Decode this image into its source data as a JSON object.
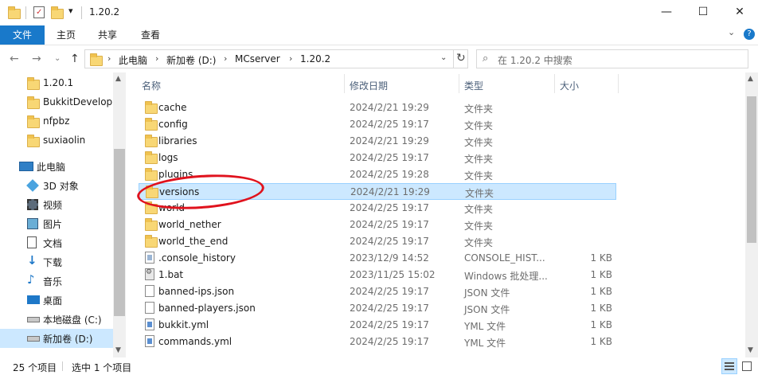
{
  "window": {
    "title": "1.20.2",
    "minimize": "—",
    "maximize": "☐",
    "close": "✕"
  },
  "ribbon": {
    "tabs": [
      {
        "label": "文件",
        "active": true
      },
      {
        "label": "主页",
        "active": false
      },
      {
        "label": "共享",
        "active": false
      },
      {
        "label": "查看",
        "active": false
      }
    ],
    "expand": "⌄",
    "help": "?"
  },
  "nav": {
    "back": "←",
    "forward": "→",
    "recent": "⌄",
    "up": "↑",
    "refresh": "↻",
    "history": "⌄"
  },
  "address": {
    "segments": [
      "此电脑",
      "新加卷 (D:)",
      "MCserver",
      "1.20.2"
    ]
  },
  "search": {
    "placeholder": "在 1.20.2 中搜索"
  },
  "navpane": {
    "folders": [
      "1.20.1",
      "BukkitDevelop",
      "nfpbz",
      "suxiaolin"
    ],
    "this_pc": "此电脑",
    "pc_items": [
      {
        "label": "3D 对象",
        "icon": "3d-objects-icon"
      },
      {
        "label": "视频",
        "icon": "video-icon"
      },
      {
        "label": "图片",
        "icon": "pictures-icon"
      },
      {
        "label": "文档",
        "icon": "documents-icon"
      },
      {
        "label": "下载",
        "icon": "downloads-icon"
      },
      {
        "label": "音乐",
        "icon": "music-icon"
      },
      {
        "label": "桌面",
        "icon": "desktop-icon"
      },
      {
        "label": "本地磁盘 (C:)",
        "icon": "drive-icon"
      },
      {
        "label": "新加卷 (D:)",
        "icon": "drive-icon"
      }
    ]
  },
  "columns": {
    "name": "名称",
    "date": "修改日期",
    "type": "类型",
    "size": "大小"
  },
  "files": [
    {
      "name": "cache",
      "date": "2024/2/21 19:29",
      "type": "文件夹",
      "size": "",
      "kind": "folder"
    },
    {
      "name": "config",
      "date": "2024/2/25 19:17",
      "type": "文件夹",
      "size": "",
      "kind": "folder"
    },
    {
      "name": "libraries",
      "date": "2024/2/21 19:29",
      "type": "文件夹",
      "size": "",
      "kind": "folder"
    },
    {
      "name": "logs",
      "date": "2024/2/25 19:17",
      "type": "文件夹",
      "size": "",
      "kind": "folder"
    },
    {
      "name": "plugins",
      "date": "2024/2/25 19:28",
      "type": "文件夹",
      "size": "",
      "kind": "folder"
    },
    {
      "name": "versions",
      "date": "2024/2/21 19:29",
      "type": "文件夹",
      "size": "",
      "kind": "folder"
    },
    {
      "name": "world",
      "date": "2024/2/25 19:17",
      "type": "文件夹",
      "size": "",
      "kind": "folder"
    },
    {
      "name": "world_nether",
      "date": "2024/2/25 19:17",
      "type": "文件夹",
      "size": "",
      "kind": "folder"
    },
    {
      "name": "world_the_end",
      "date": "2024/2/25 19:17",
      "type": "文件夹",
      "size": "",
      "kind": "folder"
    },
    {
      "name": ".console_history",
      "date": "2023/12/9 14:52",
      "type": "CONSOLE_HIST...",
      "size": "1 KB",
      "kind": "hist"
    },
    {
      "name": "1.bat",
      "date": "2023/11/25 15:02",
      "type": "Windows 批处理...",
      "size": "1 KB",
      "kind": "bat"
    },
    {
      "name": "banned-ips.json",
      "date": "2024/2/25 19:17",
      "type": "JSON 文件",
      "size": "1 KB",
      "kind": "json"
    },
    {
      "name": "banned-players.json",
      "date": "2024/2/25 19:17",
      "type": "JSON 文件",
      "size": "1 KB",
      "kind": "json"
    },
    {
      "name": "bukkit.yml",
      "date": "2024/2/25 19:17",
      "type": "YML 文件",
      "size": "1 KB",
      "kind": "yml"
    },
    {
      "name": "commands.yml",
      "date": "2024/2/25 19:17",
      "type": "YML 文件",
      "size": "1 KB",
      "kind": "yml"
    }
  ],
  "status": {
    "count": "25 个项目",
    "selected": "选中 1 个项目"
  }
}
